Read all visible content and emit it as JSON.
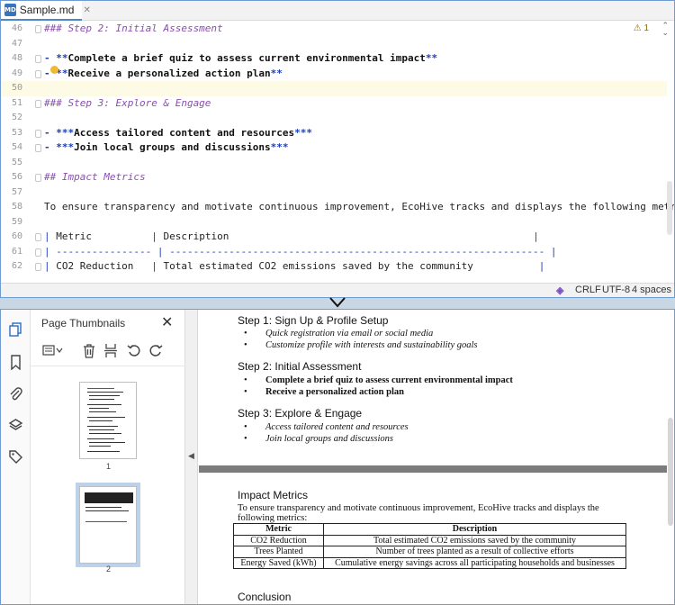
{
  "editor": {
    "tab_title": "Sample.md",
    "tab_icon": "MD",
    "inspection_count": "1",
    "lines": [
      {
        "n": "46",
        "parts": [
          {
            "c": "h",
            "t": "### Step 2: Initial Assessment"
          }
        ]
      },
      {
        "n": "47",
        "parts": []
      },
      {
        "n": "48",
        "parts": [
          {
            "c": "mk",
            "t": "- **"
          },
          {
            "c": "bold",
            "t": "Complete a brief quiz to assess current environmental impact"
          },
          {
            "c": "mk",
            "t": "**"
          }
        ]
      },
      {
        "n": "49",
        "parts": [
          {
            "c": "mk",
            "t": "- **"
          },
          {
            "c": "bold",
            "t": "Receive a personalized action plan"
          },
          {
            "c": "mk",
            "t": "**"
          }
        ]
      },
      {
        "n": "50",
        "parts": []
      },
      {
        "n": "51",
        "parts": [
          {
            "c": "h",
            "t": "### Step 3: Explore & Engage"
          }
        ]
      },
      {
        "n": "52",
        "parts": []
      },
      {
        "n": "53",
        "parts": [
          {
            "c": "mk",
            "t": "- ***"
          },
          {
            "c": "bold",
            "t": "Access tailored content and resources"
          },
          {
            "c": "mk",
            "t": "***"
          }
        ]
      },
      {
        "n": "54",
        "parts": [
          {
            "c": "mk",
            "t": "- ***"
          },
          {
            "c": "bold",
            "t": "Join local groups and discussions"
          },
          {
            "c": "mk",
            "t": "***"
          }
        ]
      },
      {
        "n": "55",
        "parts": []
      },
      {
        "n": "56",
        "parts": [
          {
            "c": "h",
            "t": "## Impact Metrics"
          }
        ]
      },
      {
        "n": "57",
        "parts": []
      },
      {
        "n": "58",
        "parts": [
          {
            "c": "plain",
            "t": "To ensure transparency and motivate continuous improvement, EcoHive tracks and displays the following metrics:"
          }
        ]
      },
      {
        "n": "59",
        "parts": []
      },
      {
        "n": "60",
        "parts": [
          {
            "c": "tbl",
            "t": "| "
          },
          {
            "c": "plain",
            "t": "Metric          "
          },
          {
            "c": "tbl",
            "t": "| "
          },
          {
            "c": "plain",
            "t": "Description                                                   "
          },
          {
            "c": "tbl",
            "t": "|"
          }
        ]
      },
      {
        "n": "61",
        "parts": [
          {
            "c": "tbl",
            "t": "| ---------------- | --------------------------------------------------------------- |"
          }
        ]
      },
      {
        "n": "62",
        "parts": [
          {
            "c": "tbl",
            "t": "| "
          },
          {
            "c": "plain",
            "t": "CO2 Reduction   "
          },
          {
            "c": "tbl",
            "t": "| "
          },
          {
            "c": "plain",
            "t": "Total estimated CO2 emissions saved by the community           "
          },
          {
            "c": "tbl",
            "t": "|"
          }
        ]
      }
    ],
    "status": {
      "line_sep": "CRLF",
      "encoding": "UTF-8",
      "indent": "4 spaces"
    }
  },
  "viewer": {
    "panel_title": "Page Thumbnails",
    "thumbnails": [
      {
        "label": "1"
      },
      {
        "label": "2"
      }
    ],
    "page": {
      "step1_heading": "Step 1: Sign Up & Profile Setup",
      "step1_items": [
        "Quick registration via email or social media",
        "Customize profile with interests and sustainability goals"
      ],
      "step2_heading": "Step 2: Initial Assessment",
      "step2_items": [
        "Complete a brief quiz to assess current environmental impact",
        "Receive a personalized action plan"
      ],
      "step3_heading": "Step 3: Explore & Engage",
      "step3_items": [
        "Access tailored content and resources",
        "Join local groups and discussions"
      ],
      "metrics_heading": "Impact Metrics",
      "metrics_intro": "To ensure transparency and motivate continuous improvement, EcoHive tracks and displays the following metrics:",
      "table_headers": [
        "Metric",
        "Description"
      ],
      "table_rows": [
        [
          "CO2 Reduction",
          "Total estimated CO2 emissions saved by the community"
        ],
        [
          "Trees Planted",
          "Number of trees planted as a result of collective efforts"
        ],
        [
          "Energy Saved (kWh)",
          "Cumulative energy savings across all participating households and businesses"
        ]
      ],
      "conclusion_heading": "Conclusion"
    }
  }
}
